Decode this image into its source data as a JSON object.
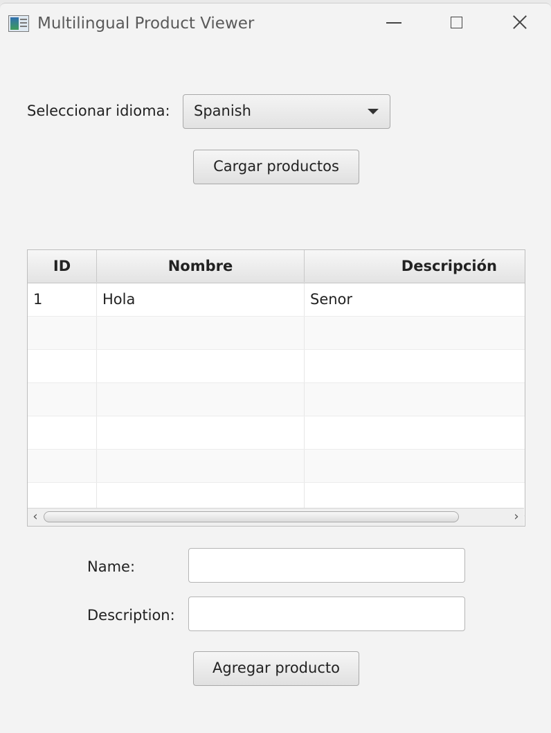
{
  "window": {
    "title": "Multilingual Product Viewer"
  },
  "language": {
    "label": "Seleccionar idioma:",
    "selected": "Spanish"
  },
  "load_button_label": "Cargar productos",
  "table": {
    "columns": [
      "ID",
      "Nombre",
      "Descripción"
    ],
    "rows": [
      [
        "1",
        "Hola",
        "Senor"
      ],
      [
        "",
        "",
        ""
      ],
      [
        "",
        "",
        ""
      ],
      [
        "",
        "",
        ""
      ],
      [
        "",
        "",
        ""
      ],
      [
        "",
        "",
        ""
      ],
      [
        "",
        "",
        ""
      ]
    ]
  },
  "form": {
    "name_label": "Name:",
    "name_value": "",
    "description_label": "Description:",
    "description_value": ""
  },
  "add_button_label": "Agregar producto"
}
